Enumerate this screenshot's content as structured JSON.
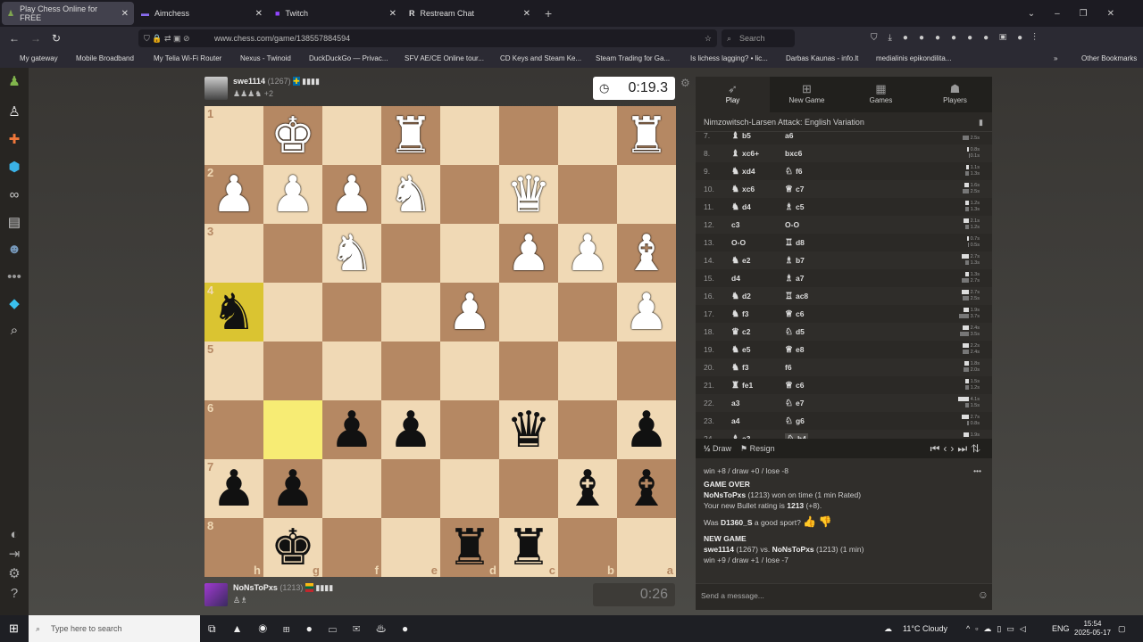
{
  "browser": {
    "tabs": [
      {
        "label": "Play Chess Online for FREE",
        "active": true
      },
      {
        "label": "Aimchess"
      },
      {
        "label": "Twitch"
      },
      {
        "label": "Restream Chat"
      }
    ],
    "url": "www.chess.com/game/138557884594",
    "search_placeholder": "Search",
    "bookmarks": [
      "My gateway",
      "Mobile Broadband",
      "My Telia Wi-Fi Router",
      "Nexus - Twinoid",
      "DuckDuckGo — Privac...",
      "SFV AE/CE Online tour...",
      "CD Keys and Steam Ke...",
      "Steam Trading for Ga...",
      "Is lichess lagging? • lic...",
      "Darbas Kaunas - info.lt",
      "medialinis epikondilita..."
    ],
    "other_bookmarks": "Other Bookmarks"
  },
  "sidebar": {
    "icons": [
      "pawn-play-icon",
      "hand-piece-icon",
      "puzzle-icon",
      "learn-cap-icon",
      "binoculars-icon",
      "news-icon",
      "friends-icon",
      "more-icon",
      "diamond-icon",
      "search-icon",
      "theme-icon",
      "logout-icon",
      "settings-icon",
      "help-icon"
    ]
  },
  "top_player": {
    "name": "swe1114",
    "rating": "(1267)",
    "flag": "Sweden",
    "captured_extra": "+2",
    "clock": "0:19.3"
  },
  "bottom_player": {
    "name": "NoNsToPxs",
    "rating": "(1213)",
    "flag": "Lithuania",
    "clock": "0:26"
  },
  "board": {
    "orientation": "black",
    "ranks": [
      "1",
      "2",
      "3",
      "4",
      "5",
      "6",
      "7",
      "8"
    ],
    "files": [
      "h",
      "g",
      "f",
      "e",
      "d",
      "c",
      "b",
      "a"
    ],
    "position": [
      [
        "",
        "K",
        "",
        "R",
        "",
        "",
        "",
        "R"
      ],
      [
        "P",
        "P",
        "P",
        "N",
        "",
        "Q",
        "",
        ""
      ],
      [
        "",
        "",
        "N",
        "",
        "",
        "P",
        "P",
        "B"
      ],
      [
        "n",
        "",
        "",
        "",
        "P",
        "",
        "",
        "P"
      ],
      [
        "",
        "",
        "",
        "",
        "",
        "",
        "",
        ""
      ],
      [
        "",
        "",
        "p",
        "p",
        "",
        "q",
        "",
        "p"
      ],
      [
        "p",
        "p",
        "",
        "",
        "",
        "",
        "b",
        "b"
      ],
      [
        "",
        "k",
        "",
        "",
        "r",
        "r",
        "",
        ""
      ]
    ],
    "highlighted": [
      "h4",
      "g6"
    ],
    "light_color": "#f0d9b5",
    "dark_color": "#b58863",
    "highlight_color": "#f7ec74"
  },
  "panel": {
    "tabs": [
      {
        "label": "Play",
        "icon": "rocket-icon"
      },
      {
        "label": "New Game",
        "icon": "plus-icon"
      },
      {
        "label": "Games",
        "icon": "board-icon"
      },
      {
        "label": "Players",
        "icon": "players-icon"
      }
    ],
    "opening": "Nimzowitsch-Larsen Attack: English Variation",
    "moves": [
      {
        "n": "7.",
        "wp": "bishop",
        "w": "b5",
        "bp": "",
        "b": "a6",
        "wt": "",
        "bt": "2.5s"
      },
      {
        "n": "8.",
        "wp": "bishop",
        "w": "xc6+",
        "bp": "",
        "b": "bxc6",
        "wt": "0.8s",
        "bt": "0.1s"
      },
      {
        "n": "9.",
        "wp": "knight",
        "w": "xd4",
        "bp": "knight",
        "b": "f6",
        "wt": "1.1s",
        "bt": "1.3s"
      },
      {
        "n": "10.",
        "wp": "knight",
        "w": "xc6",
        "bp": "queen",
        "b": "c7",
        "wt": "1.6s",
        "bt": "2.5s"
      },
      {
        "n": "11.",
        "wp": "knight",
        "w": "d4",
        "bp": "bishop",
        "b": "c5",
        "wt": "1.2s",
        "bt": "1.3s"
      },
      {
        "n": "12.",
        "wp": "",
        "w": "c3",
        "bp": "",
        "b": "O-O",
        "wt": "2.1s",
        "bt": "1.2s"
      },
      {
        "n": "13.",
        "wp": "",
        "w": "O-O",
        "bp": "rook",
        "b": "d8",
        "wt": "0.7s",
        "bt": "0.5s"
      },
      {
        "n": "14.",
        "wp": "knight",
        "w": "e2",
        "bp": "bishop",
        "b": "b7",
        "wt": "2.7s",
        "bt": "1.3s"
      },
      {
        "n": "15.",
        "wp": "",
        "w": "d4",
        "bp": "bishop",
        "b": "a7",
        "wt": "1.3s",
        "bt": "2.7s"
      },
      {
        "n": "16.",
        "wp": "knight",
        "w": "d2",
        "bp": "rook",
        "b": "ac8",
        "wt": "2.7s",
        "bt": "2.5s"
      },
      {
        "n": "17.",
        "wp": "knight",
        "w": "f3",
        "bp": "queen",
        "b": "c6",
        "wt": "1.9s",
        "bt": "3.7s"
      },
      {
        "n": "18.",
        "wp": "queen",
        "w": "c2",
        "bp": "knight",
        "b": "d5",
        "wt": "2.4s",
        "bt": "3.5s"
      },
      {
        "n": "19.",
        "wp": "knight",
        "w": "e5",
        "bp": "queen",
        "b": "e8",
        "wt": "2.2s",
        "bt": "2.4s"
      },
      {
        "n": "20.",
        "wp": "knight",
        "w": "f3",
        "bp": "",
        "b": "f6",
        "wt": "1.8s",
        "bt": "2.0s"
      },
      {
        "n": "21.",
        "wp": "rook",
        "w": "fe1",
        "bp": "queen",
        "b": "c6",
        "wt": "1.5s",
        "bt": "1.2s"
      },
      {
        "n": "22.",
        "wp": "",
        "w": "a3",
        "bp": "knight",
        "b": "e7",
        "wt": "4.1s",
        "bt": "1.5s"
      },
      {
        "n": "23.",
        "wp": "",
        "w": "a4",
        "bp": "knight",
        "b": "g6",
        "wt": "2.7s",
        "bt": "0.8s"
      },
      {
        "n": "24.",
        "wp": "bishop",
        "w": "a3",
        "bp": "knight",
        "b": "h4",
        "wt": "1.9s",
        "bt": "1.0s"
      }
    ],
    "draw": "Draw",
    "draw_icon": "½",
    "resign": "Resign",
    "chat": {
      "prev_stats": "win +8 / draw +0 / lose -8",
      "game_over": "GAME OVER",
      "winner": "NoNsToPxs",
      "winner_rest": " (1213) won on time (1 min Rated)",
      "rating_pre": "Your new Bullet rating is ",
      "rating": "1213",
      "rating_post": " (+8).",
      "sport_pre": "Was ",
      "sport_name": "D1360_S",
      "sport_post": " a good sport?",
      "new_game": "NEW GAME",
      "p1": "swe1114",
      "p1r": " (1267) vs. ",
      "p2": "NoNsToPxs",
      "p2r": " (1213) (1 min)",
      "new_stats": "win +9 / draw +1 / lose -7"
    },
    "message_placeholder": "Send a message..."
  },
  "taskbar": {
    "search": "Type here to search",
    "weather": "11°C  Cloudy",
    "lang": "ENG",
    "time": "15:54",
    "date": "2025-05-17"
  }
}
